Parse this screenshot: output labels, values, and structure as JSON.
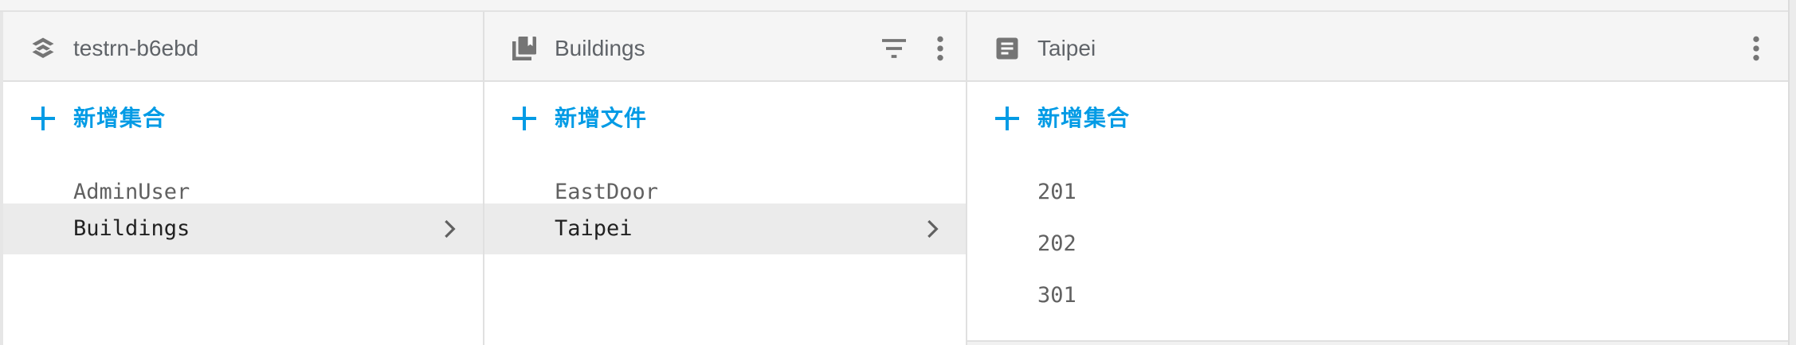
{
  "panels": [
    {
      "title": "testrn-b6ebd",
      "add_label": "新增集合",
      "items": [
        "AdminUser",
        "Buildings"
      ],
      "selected": "Buildings"
    },
    {
      "title": "Buildings",
      "add_label": "新增文件",
      "items": [
        "EastDoor",
        "Taipei"
      ],
      "selected": "Taipei"
    },
    {
      "title": "Taipei",
      "add_label": "新增集合",
      "items": [
        "201",
        "202",
        "301"
      ]
    }
  ],
  "colors": {
    "accent": "#039be5",
    "header_bg": "#f5f5f5",
    "selected_bg": "#ebebeb"
  }
}
